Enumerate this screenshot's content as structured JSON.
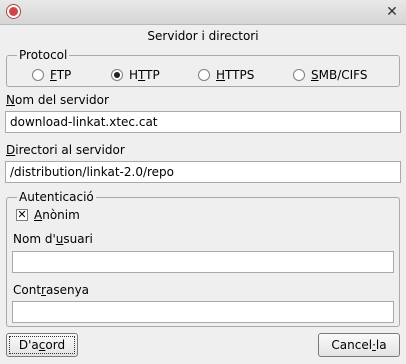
{
  "window": {
    "title": "Servidor i directori"
  },
  "protocol": {
    "legend": "Protocol",
    "options": [
      {
        "label_u": "F",
        "label_rest": "TP",
        "selected": false
      },
      {
        "label_pre": "H",
        "label_u": "T",
        "label_rest": "TP",
        "selected": true
      },
      {
        "label_u": "H",
        "label_rest": "TTPS",
        "selected": false
      },
      {
        "label_u": "S",
        "label_rest": "MB/CIFS",
        "selected": false
      }
    ]
  },
  "server": {
    "label_u": "N",
    "label_rest": "om del servidor",
    "value": "download-linkat.xtec.cat"
  },
  "directory": {
    "label_u": "D",
    "label_rest": "irectori al servidor",
    "value": "/distribution/linkat-2.0/repo"
  },
  "auth": {
    "legend": "Autenticació",
    "anonymous": {
      "label_u": "A",
      "label_rest": "nònim",
      "checked": true
    },
    "username": {
      "label_pre": "Nom d'",
      "label_u": "u",
      "label_rest": "suari",
      "value": ""
    },
    "password": {
      "label_pre": "Cont",
      "label_u": "r",
      "label_rest": "asenya",
      "value": ""
    }
  },
  "buttons": {
    "ok": {
      "label_pre": "D'a",
      "label_u": "c",
      "label_rest": "ord"
    },
    "cancel": {
      "label_pre": "Cancel",
      "label_u": "·",
      "label_rest": "la"
    }
  }
}
